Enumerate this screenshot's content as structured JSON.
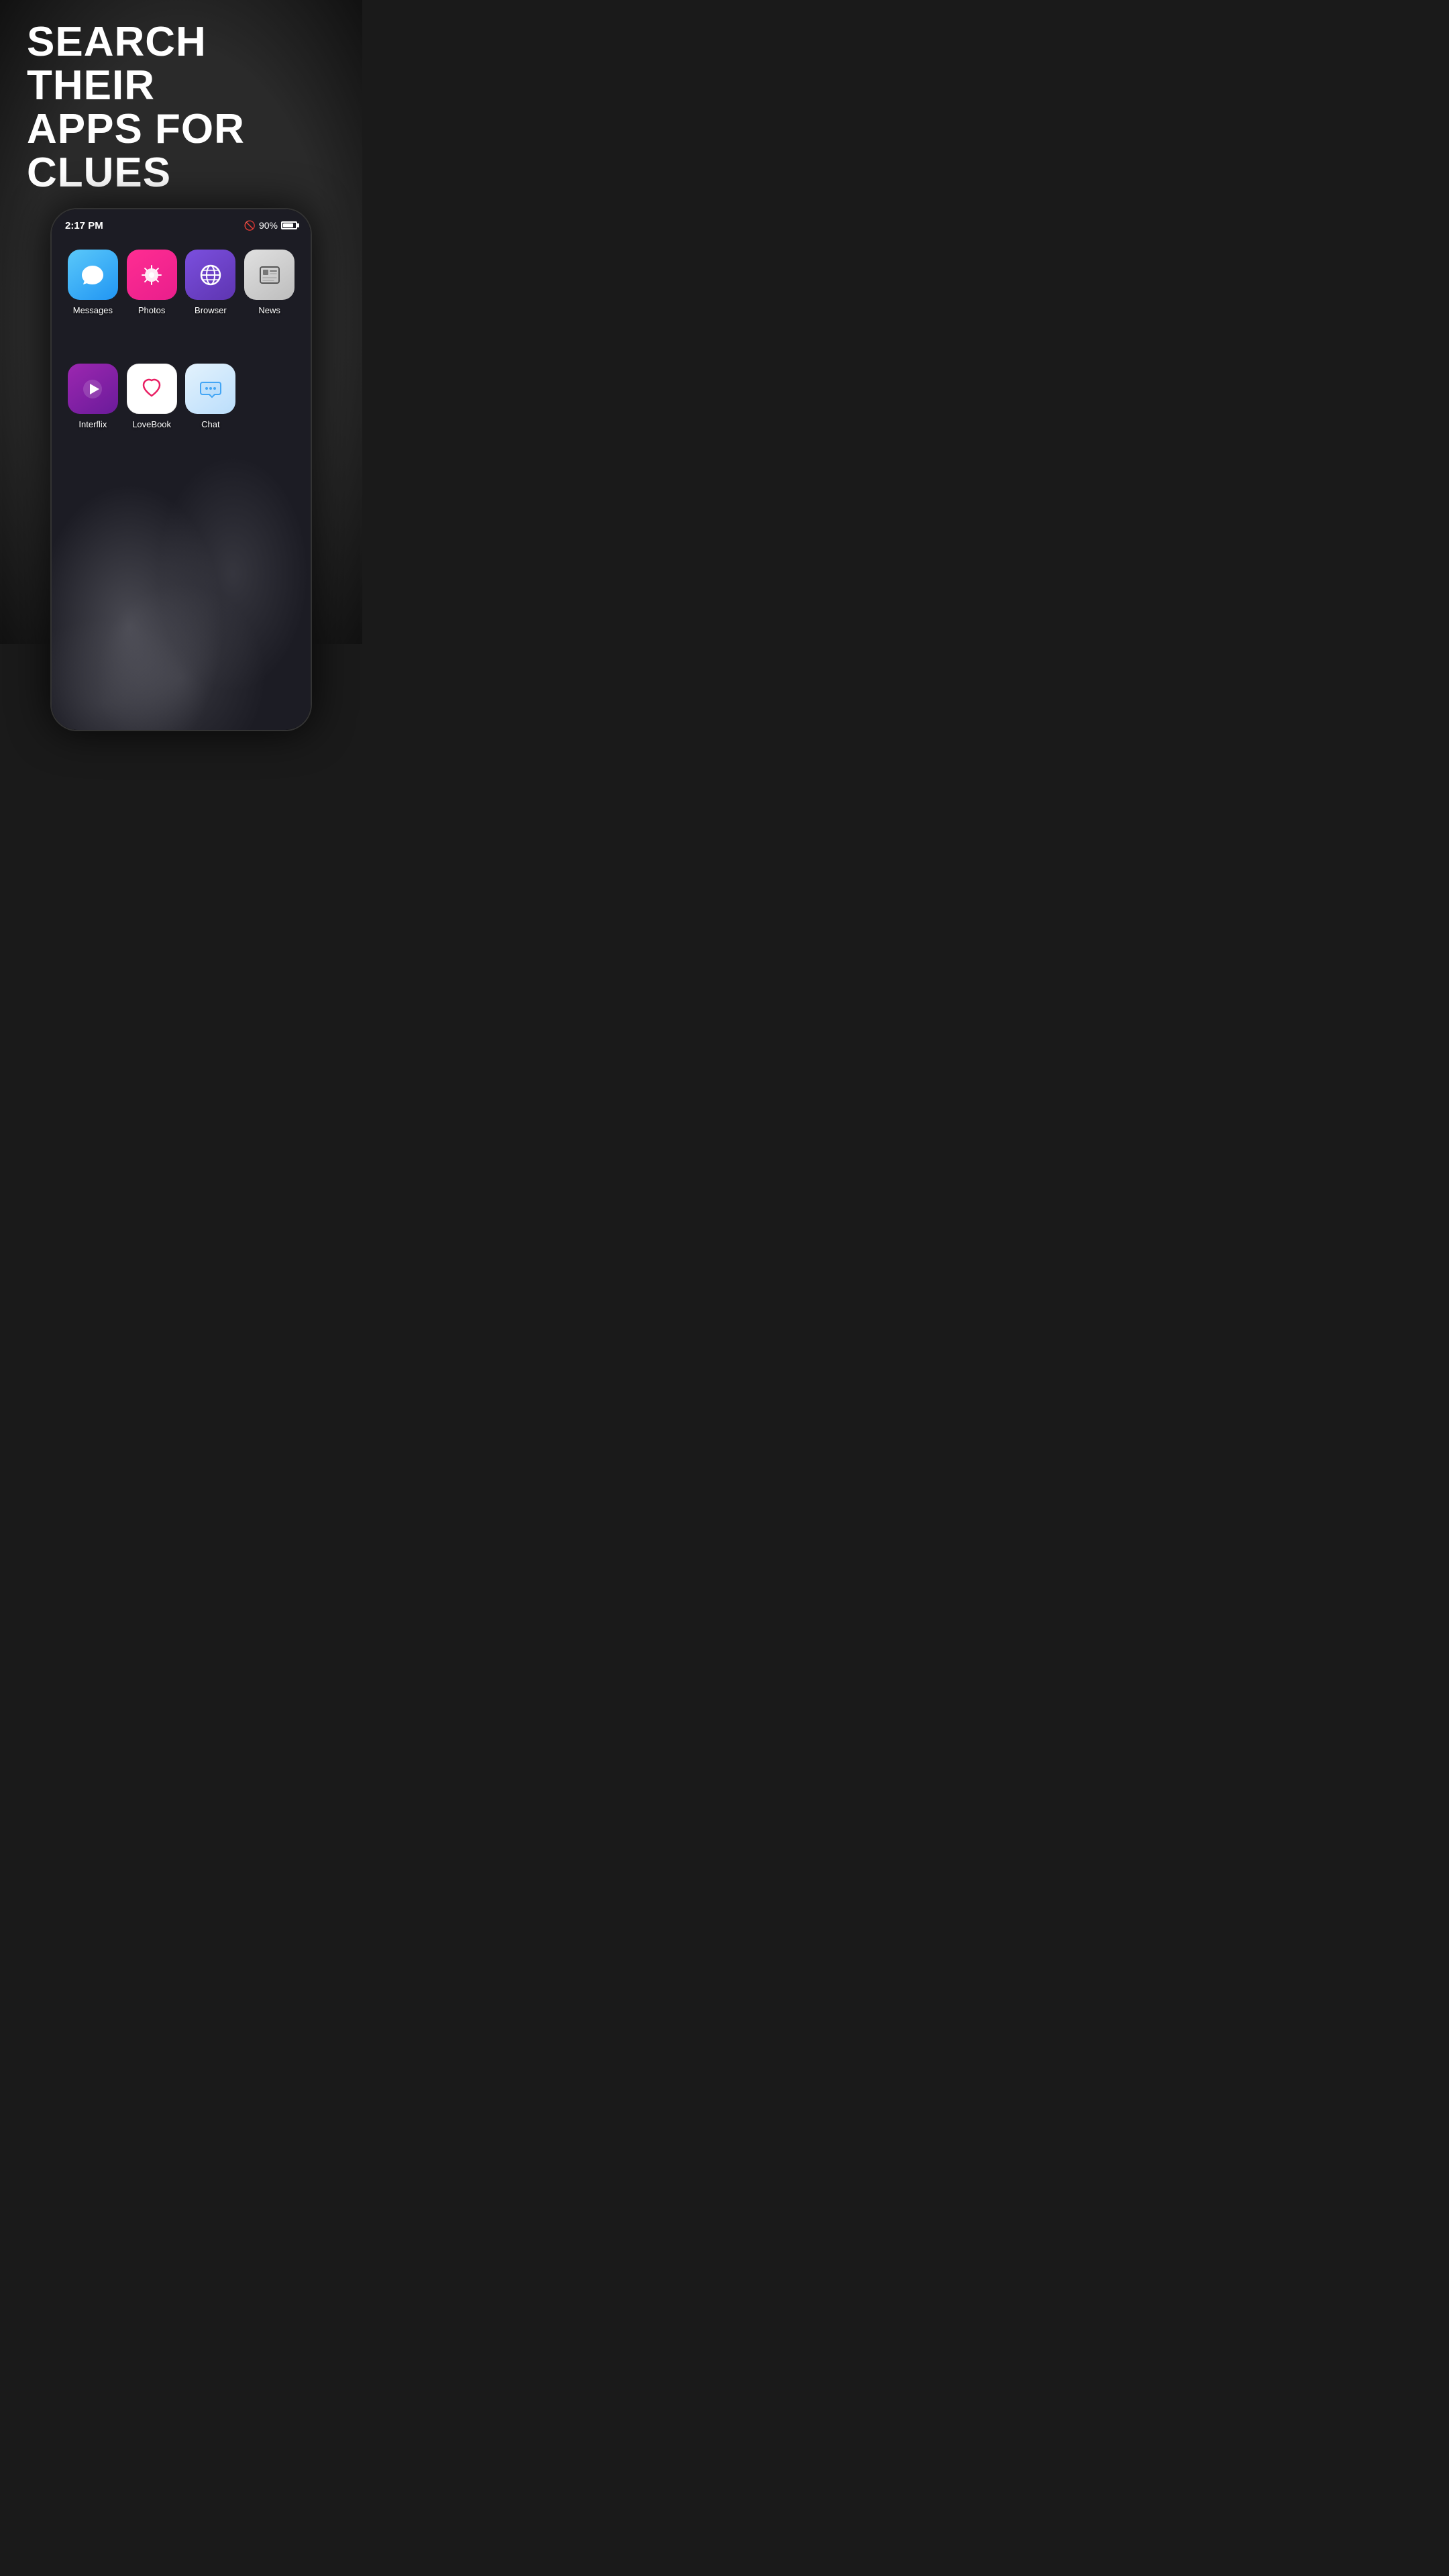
{
  "headline": {
    "line1": "SEARCH THEIR",
    "line2": "APPS FOR CLUES"
  },
  "status_bar": {
    "time": "2:17 PM",
    "battery_percent": "90%"
  },
  "apps_row1": [
    {
      "id": "messages",
      "label": "Messages",
      "icon_type": "messages"
    },
    {
      "id": "photos",
      "label": "Photos",
      "icon_type": "photos"
    },
    {
      "id": "browser",
      "label": "Browser",
      "icon_type": "browser"
    },
    {
      "id": "news",
      "label": "News",
      "icon_type": "news"
    }
  ],
  "apps_row2": [
    {
      "id": "interflix",
      "label": "Interflix",
      "icon_type": "interflix"
    },
    {
      "id": "lovebook",
      "label": "LoveBook",
      "icon_type": "lovebook"
    },
    {
      "id": "chat",
      "label": "Chat",
      "icon_type": "chat"
    }
  ]
}
